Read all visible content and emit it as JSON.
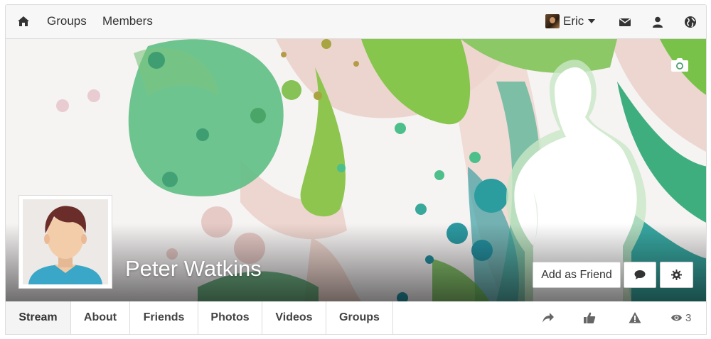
{
  "navbar": {
    "links": {
      "groups": "Groups",
      "members": "Members"
    },
    "user": {
      "name": "Eric"
    },
    "icons": [
      "home-icon",
      "envelope-icon",
      "user-icon",
      "globe-icon"
    ]
  },
  "profile": {
    "name": "Peter Watkins"
  },
  "cover_actions": {
    "add_friend_label": "Add as Friend",
    "icons": [
      "camera-icon",
      "comment-icon",
      "gear-icon"
    ]
  },
  "tabs": [
    {
      "label": "Stream",
      "active": true
    },
    {
      "label": "About"
    },
    {
      "label": "Friends"
    },
    {
      "label": "Photos"
    },
    {
      "label": "Videos"
    },
    {
      "label": "Groups"
    }
  ],
  "actions": {
    "views_count": "3",
    "icons": [
      "share-icon",
      "thumbs-up-icon",
      "warning-icon",
      "eye-icon"
    ]
  },
  "colors": {
    "green": "#7ec24a",
    "teal": "#3aa6a0",
    "pink": "#e9d2cc",
    "navbar_bg": "#f7f7f7"
  }
}
